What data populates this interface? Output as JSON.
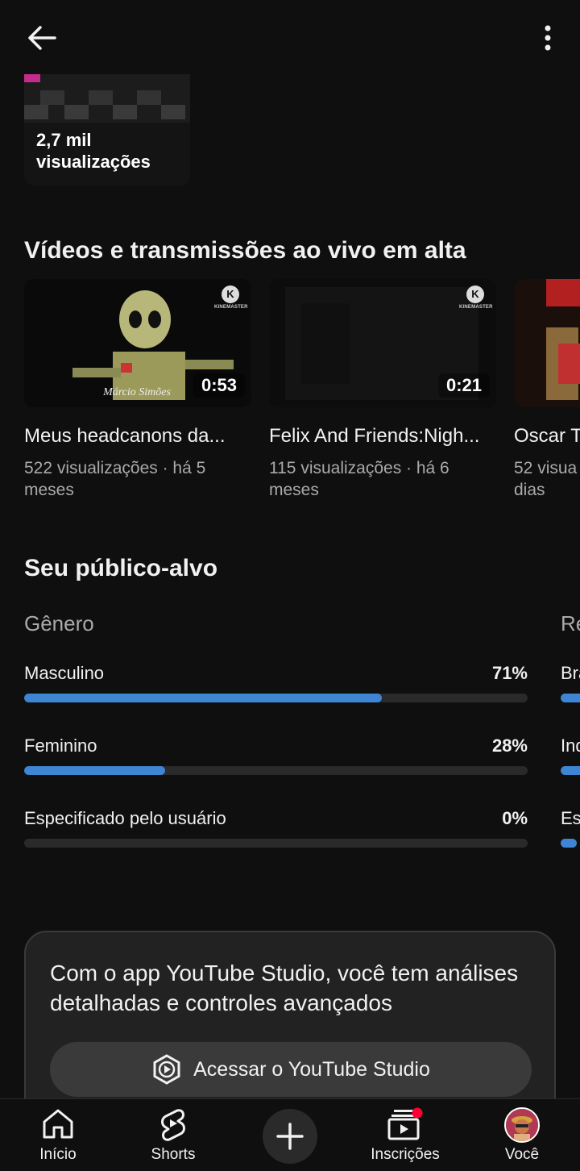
{
  "prev_card": {
    "views": "2,7 mil visualizações"
  },
  "trending": {
    "title": "Vídeos e transmissões ao vivo em alta",
    "videos": [
      {
        "title": "Meus headcanons da...",
        "meta": "522 visualizações · há 5 meses",
        "duration": "0:53",
        "thumb_caption": "Márcio Simões",
        "badge": "KINEMASTER"
      },
      {
        "title": "Felix And Friends:Nigh...",
        "meta": "115 visualizações · há 6 meses",
        "duration": "0:21",
        "badge": "KINEMASTER"
      },
      {
        "title": "Oscar T",
        "meta": "52 visua dias"
      }
    ]
  },
  "audience": {
    "title": "Seu público-alvo",
    "gender": {
      "heading": "Gênero",
      "rows": [
        {
          "label": "Masculino",
          "value": "71%",
          "fraction": 0.71
        },
        {
          "label": "Feminino",
          "value": "28%",
          "fraction": 0.28
        },
        {
          "label": "Especificado pelo usuário",
          "value": "0%",
          "fraction": 0.0
        }
      ]
    },
    "region_peek": {
      "heading": "Re",
      "rows": [
        "Bra",
        "Ind",
        "Es"
      ]
    }
  },
  "studio_promo": {
    "text": "Com o app YouTube Studio, você tem análises detalhadas e controles avançados",
    "button": "Acessar o YouTube Studio"
  },
  "nav": {
    "home": "Início",
    "shorts": "Shorts",
    "subscriptions": "Inscrições",
    "you": "Você"
  },
  "colors": {
    "bar": "#3e86d4",
    "notification": "#ff0033",
    "background": "#0f0f0f"
  }
}
